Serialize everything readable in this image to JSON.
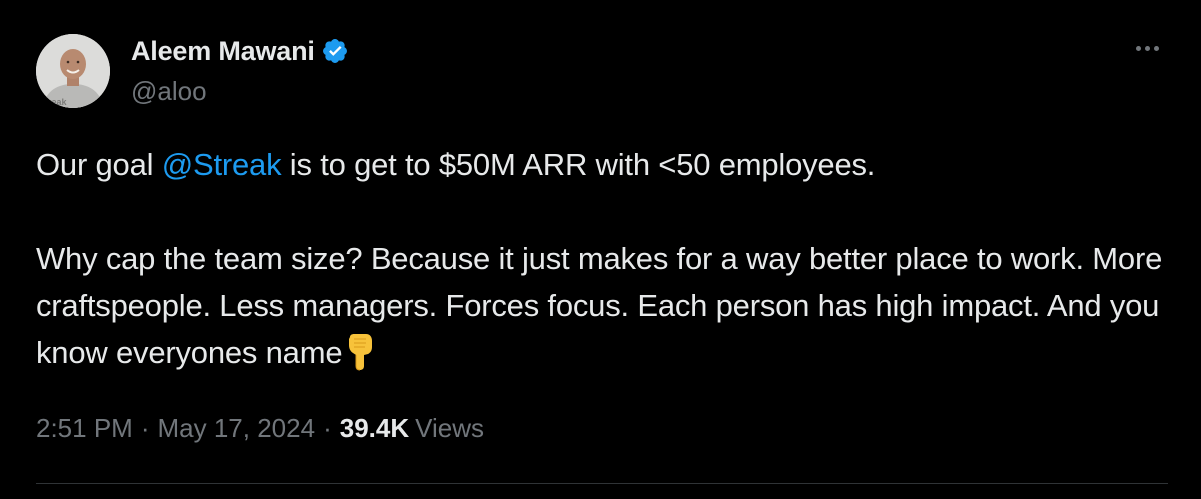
{
  "author": {
    "display_name": "Aleem Mawani",
    "handle": "@aloo",
    "verified": true,
    "verified_color": "#1d9bf0",
    "avatar_shirt_text": "streak"
  },
  "tweet": {
    "line1_prefix": "Our goal ",
    "mention": "@Streak",
    "line1_suffix": " is to get to $50M ARR with <50 employees.",
    "paragraph2": "Why cap the team size? Because it just makes for a way better place to work. More craftspeople. Less managers. Forces focus. Each person has high impact. And you know everyones name",
    "emoji": "point-down-emoji"
  },
  "meta": {
    "time": "2:51 PM",
    "separator": "·",
    "date": "May 17, 2024",
    "views_count": "39.4K",
    "views_label": "Views"
  },
  "colors": {
    "background": "#000000",
    "text": "#e7e9ea",
    "muted": "#71767b",
    "link": "#1d9bf0",
    "divider": "#2f3336"
  },
  "icons": {
    "more": "more-dots-icon",
    "verified": "verified-badge-icon"
  }
}
